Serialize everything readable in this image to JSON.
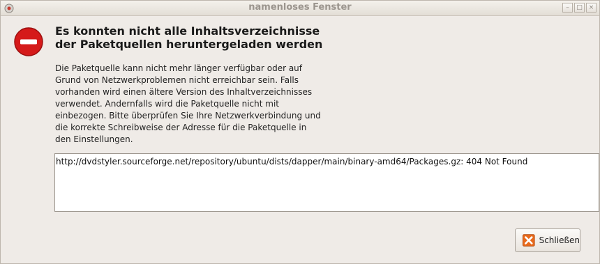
{
  "window": {
    "title": "namenloses Fenster",
    "minimize_glyph": "–",
    "maximize_glyph": "□",
    "close_glyph": "×"
  },
  "dialog": {
    "heading_line1": "Es konnten nicht alle Inhaltsverzeichnisse",
    "heading_line2": "der Paketquellen heruntergeladen werden",
    "body_lines": [
      "Die Paketquelle kann nicht mehr länger verfügbar oder auf",
      "Grund von Netzwerkproblemen nicht erreichbar sein. Falls",
      "vorhanden wird einen ältere Version des Inhaltverzeichnisses",
      "verwendet. Andernfalls wird die Paketquelle nicht mit",
      "einbezogen. Bitte überprüfen Sie Ihre Netzwerkverbindung und",
      "die korrekte Schreibweise der Adresse für die Paketquelle in",
      "den Einstellungen."
    ],
    "details": "http://dvdstyler.sourceforge.net/repository/ubuntu/dists/dapper/main/binary-amd64/Packages.gz: 404 Not Found",
    "close_button_label": "Schließen"
  },
  "icons": {
    "app": "app-icon",
    "error": "error-icon",
    "close": "close-icon"
  },
  "colors": {
    "error_red": "#d51a1a",
    "close_icon_orange": "#e86a1c"
  }
}
